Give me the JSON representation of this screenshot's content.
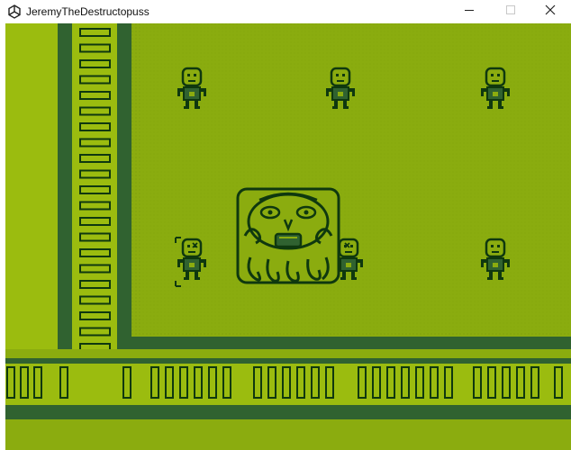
{
  "window": {
    "title": "JeremyTheDestructopuss"
  },
  "icons": {
    "app": "unity-logo-icon",
    "minimize": "minimize-icon",
    "maximize": "maximize-icon",
    "close": "close-icon"
  },
  "palette": {
    "light": "#9bbc0f",
    "field": "#8bac0f",
    "track": "#306230",
    "dark": "#0f380f",
    "frame": "#ffffff"
  }
}
